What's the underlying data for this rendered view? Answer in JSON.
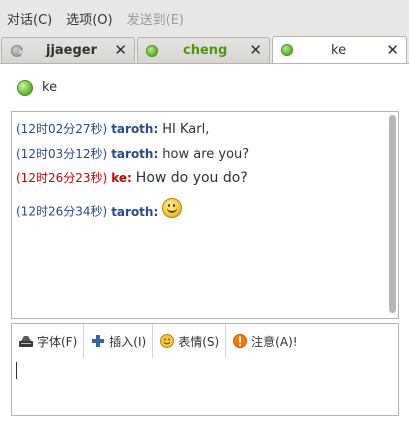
{
  "menu": {
    "items": [
      "对话(C)",
      "选项(O)",
      "发送到(E)"
    ]
  },
  "tabs": [
    {
      "label": "jjaeger",
      "close": "✕"
    },
    {
      "label": "cheng",
      "close": "✕"
    },
    {
      "label": "ke",
      "close": "✕"
    }
  ],
  "contact": {
    "name": "ke"
  },
  "messages": [
    {
      "time": "(12时02分27秒)",
      "sender": "taroth:",
      "text": "HI Karl,"
    },
    {
      "time": "(12时03分12秒)",
      "sender": "taroth:",
      "text": "how are you?"
    },
    {
      "time": "(12时26分23秒)",
      "sender": "ke:",
      "text": "How do you do?"
    },
    {
      "time": "(12时26分34秒)",
      "sender": "taroth:",
      "text": ""
    }
  ],
  "toolbar": {
    "font": "字体(F)",
    "insert": "插入(I)",
    "emotion": "表情(S)",
    "attention": "注意(A)!"
  },
  "colors": {
    "local_sender": "#2a4a8a",
    "remote_sender": "#cc0000",
    "online": "#5ab12a"
  },
  "icons": {
    "offline_status": "offline-status-icon",
    "online_status": "online-status-icon",
    "smiley": "smiley-icon",
    "font": "font-icon",
    "insert": "plus-icon",
    "emotion": "smiley-icon",
    "attention": "warning-icon"
  }
}
